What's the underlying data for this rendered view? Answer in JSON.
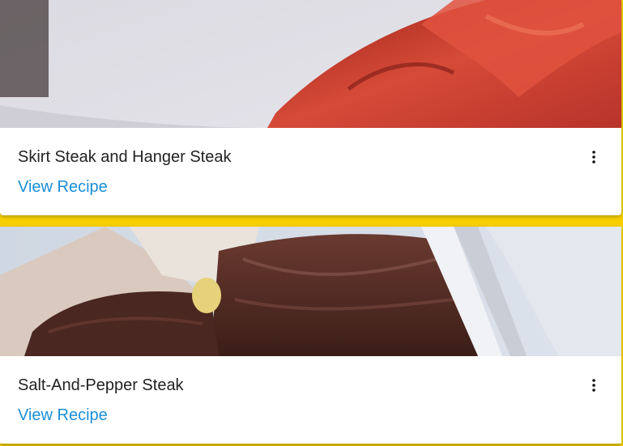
{
  "recipes": [
    {
      "title": "Skirt Steak and Hanger Steak",
      "link_label": "View Recipe",
      "menu_icon": "more-vertical-icon"
    },
    {
      "title": "Salt-And-Pepper Steak",
      "link_label": "View Recipe",
      "menu_icon": "more-vertical-icon"
    }
  ],
  "colors": {
    "accent_band": "#f6cf00",
    "link": "#1a8fd6",
    "card_background": "#ffffff",
    "title_text": "#222222"
  }
}
